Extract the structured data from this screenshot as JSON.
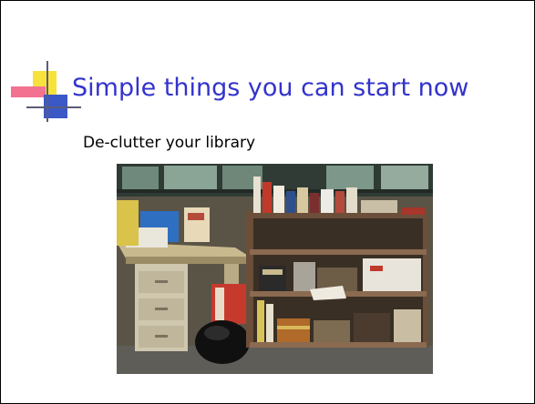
{
  "slide": {
    "title": "Simple things you can start now",
    "subtitle": "De-clutter your library"
  },
  "photo": {
    "content": "library-desk-and-cluttered-bookshelf"
  },
  "colors": {
    "title": "#3333cc",
    "accent_yellow": "#f7e23c",
    "accent_pink": "#f2728f",
    "accent_blue": "#3a58c6"
  }
}
